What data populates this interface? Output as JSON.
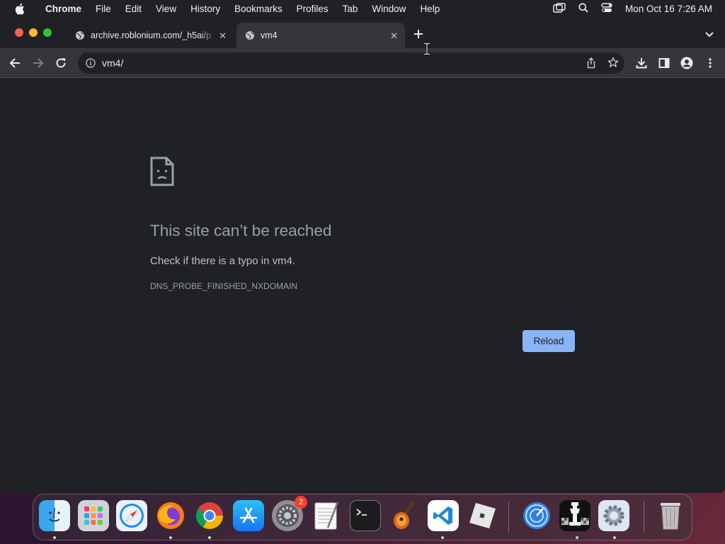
{
  "menubar": {
    "app_name": "Chrome",
    "items": [
      "File",
      "Edit",
      "View",
      "History",
      "Bookmarks",
      "Profiles",
      "Tab",
      "Window",
      "Help"
    ],
    "clock": "Mon Oct 16  7:26 AM"
  },
  "tabs": [
    {
      "title": "archive.roblonium.com/_h5ai/p",
      "active": false
    },
    {
      "title": "vm4",
      "active": true
    }
  ],
  "omnibox": {
    "url": "vm4/"
  },
  "error_page": {
    "title": "This site can’t be reached",
    "message": "Check if there is a typo in vm4.",
    "code": "DNS_PROBE_FINISHED_NXDOMAIN",
    "reload_label": "Reload"
  },
  "dock": {
    "apps": [
      "finder",
      "launchpad",
      "safari",
      "firefox",
      "chrome",
      "app-store",
      "system-preferences",
      "textedit",
      "terminal",
      "garageband",
      "vscode",
      "roblox",
      "network-utility",
      "chess",
      "settings-gear",
      "trash"
    ],
    "system_preferences_badge": "2"
  },
  "colors": {
    "accent": "#8ab4f8",
    "page_bg": "#202124",
    "toolbar_bg": "#35363a"
  }
}
